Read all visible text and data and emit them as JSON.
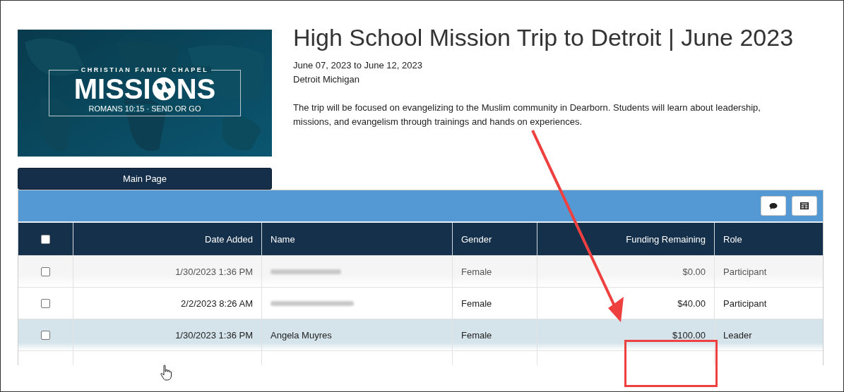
{
  "banner": {
    "org": "CHRISTIAN FAMILY CHAPEL",
    "headline_left": "MISSI",
    "headline_right": "NS",
    "tagline": "ROMANS 10:15 · SEND OR GO"
  },
  "main_button": "Main Page",
  "trip": {
    "title": "High School Mission Trip to Detroit | June 2023",
    "dates": "June 07, 2023 to June 12, 2023",
    "location": "Detroit Michigan",
    "description": "The trip will be focused on evangelizing to the Muslim community in Dearborn. Students will learn about leadership, missions, and evangelism through trainings and hands on experiences."
  },
  "table": {
    "select_all_checked": false,
    "columns": [
      "Date Added",
      "Name",
      "Gender",
      "Funding Remaining",
      "Role"
    ],
    "rows": [
      {
        "checked": false,
        "highlighted": false,
        "name_redacted": true,
        "date": "1/30/2023 1:36 PM",
        "gender": "Female",
        "funding": "$0.00",
        "role": "Participant"
      },
      {
        "checked": false,
        "highlighted": false,
        "name_redacted": true,
        "date": "2/2/2023 8:26 AM",
        "gender": "Female",
        "funding": "$40.00",
        "role": "Participant"
      },
      {
        "checked": false,
        "highlighted": true,
        "name_redacted": false,
        "date": "1/30/2023 1:36 PM",
        "name": "Angela Muyres",
        "gender": "Female",
        "funding": "$100.00",
        "role": "Leader"
      }
    ]
  }
}
